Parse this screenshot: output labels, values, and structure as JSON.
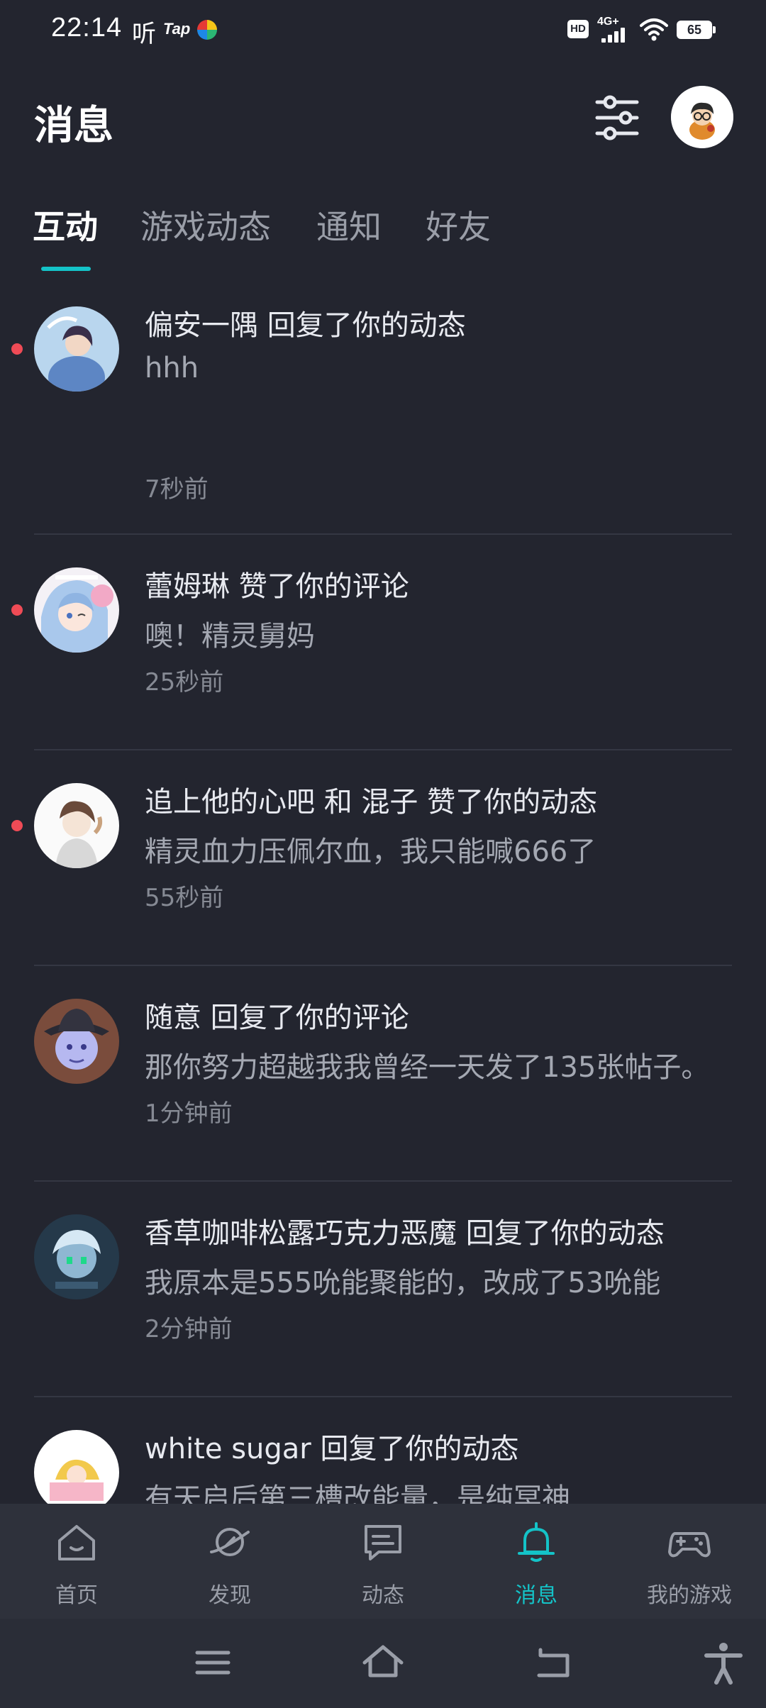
{
  "status_bar": {
    "time": "22:14",
    "extra_char": "听",
    "tap_label": "Tap",
    "hd_label": "HD",
    "network": "4G+",
    "battery": "65"
  },
  "header": {
    "title": "消息"
  },
  "tabs": [
    {
      "label": "互动",
      "active": true
    },
    {
      "label": "游戏动态",
      "active": false
    },
    {
      "label": "通知",
      "active": false
    },
    {
      "label": "好友",
      "active": false
    }
  ],
  "messages": [
    {
      "title": "偏安一隅 回复了你的动态",
      "body": "hhh",
      "time": "7秒前",
      "unread": true
    },
    {
      "title": "蕾姆琳 赞了你的评论",
      "body": "噢！精灵舅妈",
      "time": "25秒前",
      "unread": true
    },
    {
      "title": "追上他的心吧 和 混子 赞了你的动态",
      "body": "精灵血力压佩尔血，我只能喊666了",
      "time": "55秒前",
      "unread": true
    },
    {
      "title": "随意 回复了你的评论",
      "body": "那你努力超越我我曾经一天发了135张帖子。",
      "time": "1分钟前",
      "unread": false
    },
    {
      "title": "香草咖啡松露巧克力恶魔 回复了你的动态",
      "body": "我原本是555吮能聚能的，改成了53吮能",
      "time": "2分钟前",
      "unread": false
    },
    {
      "title": "white sugar 回复了你的动态",
      "body": "有天启后第三槽改能量，是纯冥神",
      "time": "",
      "unread": false
    }
  ],
  "bottom_nav": [
    {
      "label": "首页",
      "icon": "home-icon",
      "active": false
    },
    {
      "label": "发现",
      "icon": "planet-icon",
      "active": false
    },
    {
      "label": "动态",
      "icon": "chat-icon",
      "active": false
    },
    {
      "label": "消息",
      "icon": "bell-icon",
      "active": true
    },
    {
      "label": "我的游戏",
      "icon": "gamepad-icon",
      "active": false
    }
  ],
  "system_nav": [
    "menu-icon",
    "home-outline-icon",
    "back-icon",
    "accessibility-icon"
  ],
  "colors": {
    "background": "#23252f",
    "accent": "#14c3c8",
    "unread": "#ef4b56"
  }
}
